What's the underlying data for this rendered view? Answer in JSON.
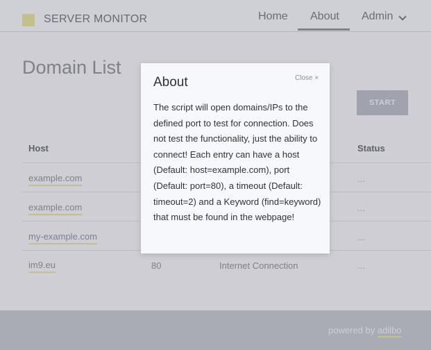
{
  "header": {
    "brand": "SERVER MONITOR",
    "nav": {
      "home": "Home",
      "about": "About",
      "admin": "Admin"
    }
  },
  "main": {
    "title": "Domain List",
    "start_label": "START",
    "columns": {
      "host": "Host",
      "status": "Status"
    },
    "rows": [
      {
        "host": "example.com",
        "port": "",
        "type": "",
        "status": "..."
      },
      {
        "host": "example.com",
        "port": "",
        "type": "",
        "status": "..."
      },
      {
        "host": "my-example.com",
        "port": "",
        "type": "",
        "status": "..."
      },
      {
        "host": "im9.eu",
        "port": "80",
        "type": "Internet Connection",
        "status": "..."
      }
    ]
  },
  "footer": {
    "prefix": "powered by ",
    "brand": "adilbo"
  },
  "modal": {
    "title": "About",
    "close_label": "Close ×",
    "body": "The script will open domains/IPs to the defined port to test for connection. Does not test the functionality, just the ability to connect! Each entry can have a host (Default: host=example.com), port (Default: port=80), a timeout (Default: timeout=2) and a Keyword (find=keyword) that must be found in the webpage!"
  },
  "colors": {
    "accent": "#e7e29a",
    "footer_bg": "#c3c6cf",
    "button_bg": "#b7bbc6"
  }
}
